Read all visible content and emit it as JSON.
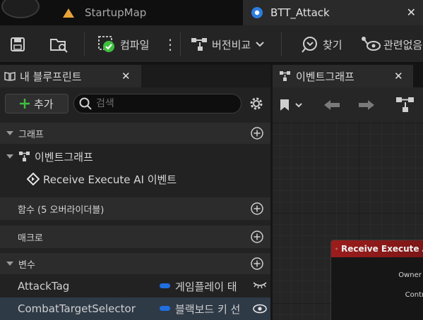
{
  "tabs": [
    {
      "label": "StartupMap"
    },
    {
      "label": "BTT_Attack"
    }
  ],
  "toolbar": {
    "compile_label": "컴파일",
    "diff_label": "버전비교",
    "find_label": "찾기",
    "hide_unrelated_label": "관련없음"
  },
  "panel": {
    "title": "내 블루프린트",
    "add_label": "추가",
    "search_placeholder": "검색"
  },
  "sections": {
    "graphs": "그래프",
    "functions": "함수 (5 오버라이더블)",
    "macros": "매크로",
    "variables": "변수"
  },
  "graph_items": [
    {
      "label": "이벤트그래프"
    },
    {
      "label": "Receive Execute AI 이벤트"
    }
  ],
  "variables": [
    {
      "name": "AttackTag",
      "type": "게임플레이 태"
    },
    {
      "name": "CombatTargetSelector",
      "type": "블랙보드 키 선"
    }
  ],
  "graph_panel": {
    "title": "이벤트그래프",
    "node_title": "Receive Execute A",
    "pins": [
      "Owner C",
      "Contro"
    ]
  },
  "colors": {
    "accent_green": "#3fbf3f",
    "variable_pin": "#1f6fe0",
    "node_header": "#9c1c1c"
  }
}
